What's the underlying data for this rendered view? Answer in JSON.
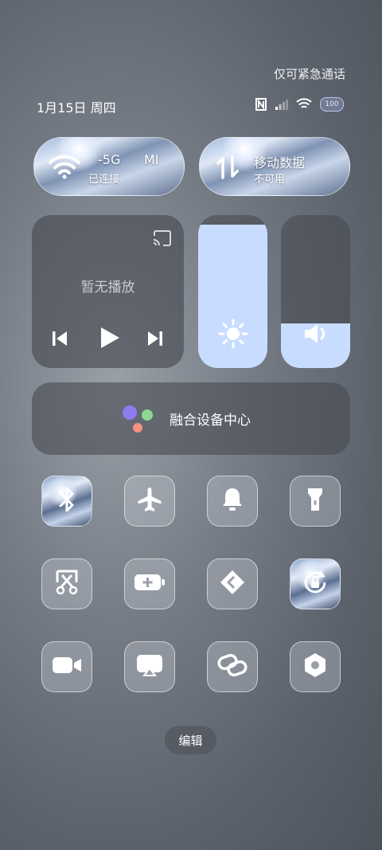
{
  "header": {
    "emergency_text": "仅可紧急通话",
    "date_text": "1月15日 周四",
    "battery_level": "100"
  },
  "wifi_tile": {
    "title": "-5G",
    "title_extra": "MI",
    "subtitle": "已连接",
    "active": true
  },
  "data_tile": {
    "title": "移动数据",
    "subtitle": "不可用",
    "active": false
  },
  "media": {
    "title": "暂无播放"
  },
  "brightness_level": 0.94,
  "volume_level": 0.29,
  "device_hub": {
    "label": "融合设备中心"
  },
  "toggles": [
    {
      "name": "bluetooth",
      "icon": "bluetooth-icon",
      "active": true
    },
    {
      "name": "airplane-mode",
      "icon": "airplane-icon",
      "active": false
    },
    {
      "name": "sound",
      "icon": "bell-icon",
      "active": false
    },
    {
      "name": "flashlight",
      "icon": "flashlight-icon",
      "active": false
    },
    {
      "name": "screenshot",
      "icon": "scissors-icon",
      "active": false
    },
    {
      "name": "battery-saver",
      "icon": "battery-plus-icon",
      "active": false
    },
    {
      "name": "nearby-share",
      "icon": "share-diamond-icon",
      "active": false
    },
    {
      "name": "rotation-lock",
      "icon": "rotation-lock-icon",
      "active": true
    },
    {
      "name": "screen-record",
      "icon": "video-camera-icon",
      "active": false
    },
    {
      "name": "cast",
      "icon": "screen-cast-icon",
      "active": false
    },
    {
      "name": "link",
      "icon": "link-icon",
      "active": false
    },
    {
      "name": "settings",
      "icon": "hexagon-gear-icon",
      "active": false
    }
  ],
  "edit_label": "编辑",
  "colors": {
    "slider_fill": "#c8dcff",
    "accent_hub": [
      "#8d7cf0",
      "#8fd88f",
      "#f3907e"
    ]
  }
}
